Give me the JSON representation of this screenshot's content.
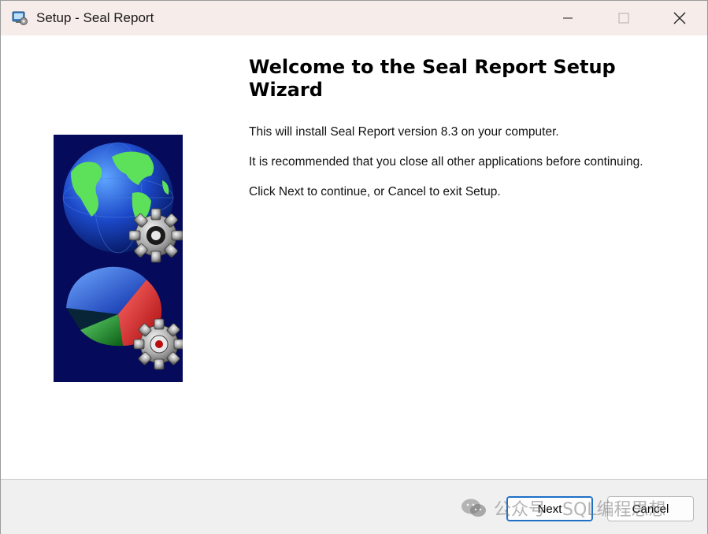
{
  "window": {
    "title": "Setup - Seal Report"
  },
  "titlebar": {
    "icons": [
      "app-setup-icon",
      "minimize-icon",
      "maximize-icon",
      "close-icon"
    ]
  },
  "content": {
    "heading": "Welcome to the Seal Report Setup Wizard",
    "paragraphs": [
      "This will install Seal Report version 8.3 on your computer.",
      "It is recommended that you close all other applications before continuing.",
      "Click Next to continue, or Cancel to exit Setup."
    ],
    "logo_icons": [
      "globe-icon",
      "gear-icon",
      "pie-chart-icon"
    ]
  },
  "footer": {
    "next_label": "Next",
    "cancel_label": "Cancel",
    "watermark_text": "公众号 · SQL编程思想"
  },
  "colors": {
    "titlebar_bg": "#f6ece9",
    "logo_bg": "#050a5a",
    "default_button_border": "#1f6fc7",
    "footer_bg": "#f0f0f0"
  }
}
